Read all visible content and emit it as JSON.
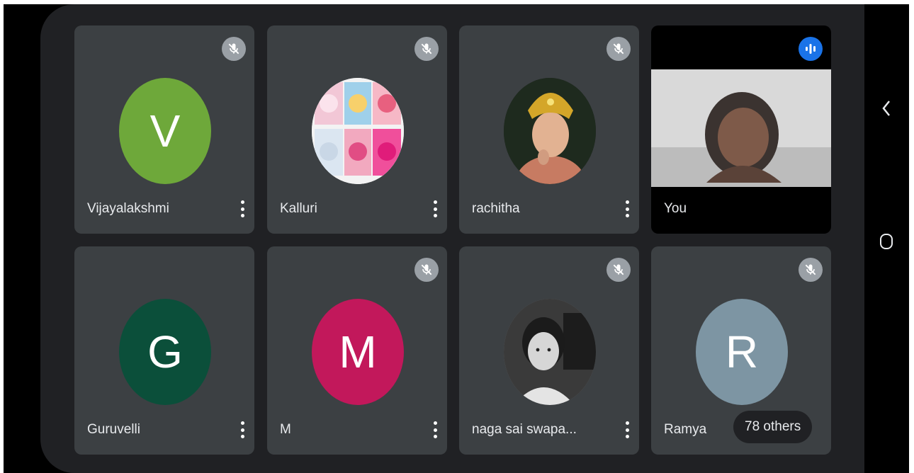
{
  "participants_row1": [
    {
      "name": "Vijayalakshmi",
      "initial": "V",
      "avatar_color": "#6ea83a",
      "muted": true
    },
    {
      "name": "Kalluri",
      "initial": "",
      "avatar_color": "#ffffff",
      "muted": true,
      "photo": "teddy-bears-collage"
    },
    {
      "name": "rachitha",
      "initial": "",
      "avatar_color": "#1b1b1b",
      "muted": true,
      "photo": "person-with-gold-crown"
    },
    {
      "name": "You",
      "is_self": true,
      "speaking": true
    }
  ],
  "participants_row2": [
    {
      "name": "Guruvelli",
      "initial": "G",
      "avatar_color": "#0b4f3a",
      "muted": false
    },
    {
      "name": "M",
      "initial": "M",
      "avatar_color": "#c2185b",
      "muted": true
    },
    {
      "name": "naga sai swapa...",
      "initial": "",
      "avatar_color": "#777777",
      "muted": true,
      "photo": "grayscale-portrait"
    },
    {
      "name": "Ramya",
      "initial": "R",
      "avatar_color": "#7d95a3",
      "muted": true
    }
  ],
  "others_label": "78 others",
  "icons": {
    "mute": "mic-off-icon",
    "speaking": "audio-wave-icon",
    "more": "more-vert-icon",
    "back": "chevron-left-icon",
    "home": "home-icon"
  }
}
